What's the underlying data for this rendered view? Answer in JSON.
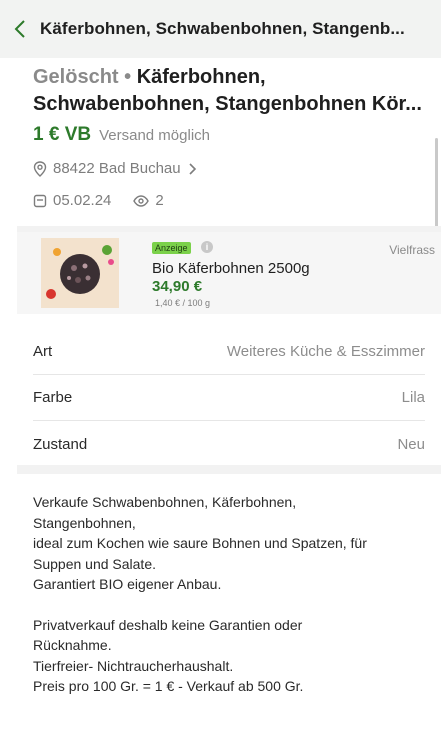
{
  "header": {
    "title": "Käferbohnen, Schwabenbohnen, Stangenb..."
  },
  "listing": {
    "status": "Gelöscht",
    "separator": " • ",
    "title_line1": "Käferbohnen,",
    "title_line2": "Schwabenbohnen, Stangenbohnen Kör...",
    "price": "1 € VB",
    "shipping": "Versand möglich",
    "location": "88422 Bad Buchau",
    "date": "05.02.24",
    "views": "2"
  },
  "ad": {
    "badge": "Anzeige",
    "info": "i",
    "brand": "Vielfrass",
    "title": "Bio Käferbohnen 2500g",
    "price": "34,90 €",
    "unit_price": "1,40 € / 100 g"
  },
  "attributes": [
    {
      "key": "Art",
      "value": "Weiteres Küche & Esszimmer"
    },
    {
      "key": "Farbe",
      "value": "Lila"
    },
    {
      "key": "Zustand",
      "value": "Neu"
    }
  ],
  "description": {
    "paragraph1": [
      "Verkaufe Schwabenbohnen, Käferbohnen,",
      "Stangenbohnen,",
      "ideal zum Kochen wie saure Bohnen und Spatzen, für",
      "Suppen und Salate.",
      "Garantiert BIO eigener Anbau."
    ],
    "paragraph2": [
      "Privatverkauf deshalb keine Garantien oder",
      "Rücknahme.",
      "Tierfreier- Nichtraucherhaushalt.",
      "Preis pro 100 Gr. = 1 € - Verkauf ab 500 Gr."
    ]
  },
  "icons": {
    "back": "chevron-left-icon",
    "location": "map-pin-icon",
    "calendar": "calendar-icon",
    "views": "eye-icon",
    "chevron": "chevron-right-icon"
  },
  "colors": {
    "accent_green": "#2d7a2b",
    "badge_green": "#7bd14a"
  }
}
